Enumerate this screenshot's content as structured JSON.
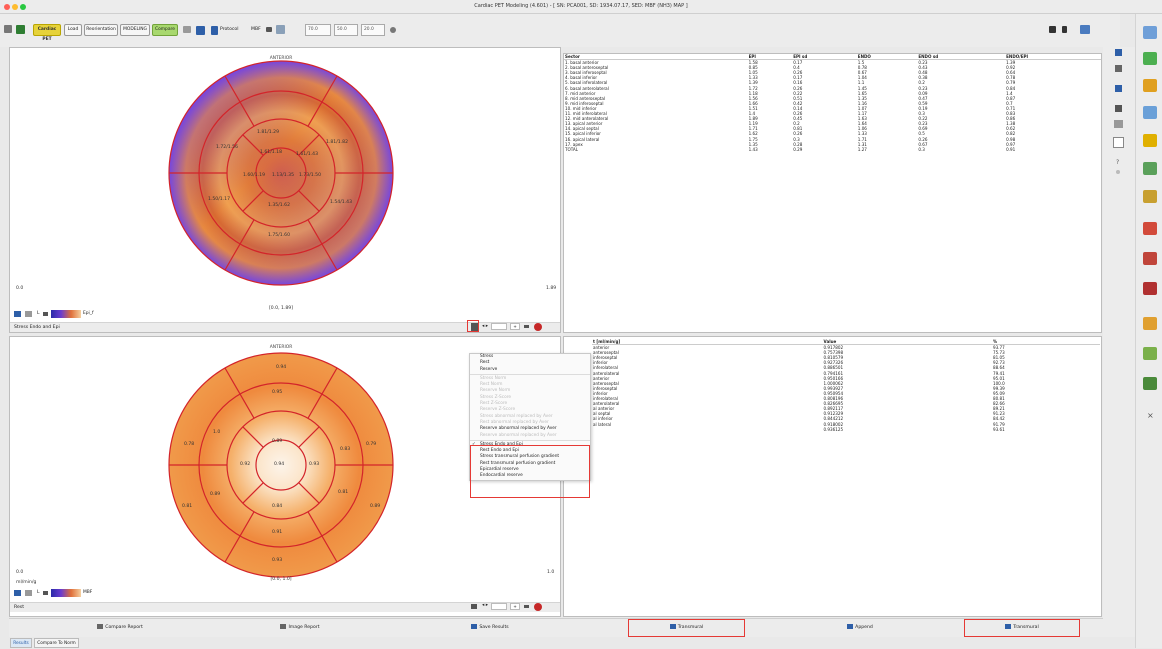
{
  "window": {
    "title": "Cardiac PET Modeling (4.601) - [ SN: PCA001, SD: 1934.07.17, SED: MBF (NH3) MAP ]"
  },
  "toolbar": {
    "mode_label": "Cardiac PET",
    "buttons": [
      "Load",
      "Reorientation",
      "MODELING",
      "Compare"
    ],
    "protocol_label": "Protocol",
    "mbf_label": "MBF",
    "field1": "70.0",
    "field2": "50.0",
    "field3": "20.0"
  },
  "top_panel": {
    "anterior_label": "ANTERIOR",
    "scale_min": "0.0",
    "scale_max": "1.89",
    "range_label": "[0.0, 1.89]",
    "colorbar_label": "Epi_f",
    "dropdown_label": "Stress Endo and Epi",
    "rings": {
      "outer": [
        "1.81/1.29",
        "1.81/1.75",
        "1.81/1.82",
        "1.79/1.23",
        "1.75/1.60",
        "1.72/1.56"
      ],
      "middle": [
        "1.61/1.18",
        "1.61/1.43",
        "1.57/1.42",
        "1.54/1.43",
        "1.53/1.43",
        "1.50/1.17"
      ],
      "inner": [
        "1.60/1.19",
        "1.73/1.50",
        "1.35/1.62",
        "1.57/1.23"
      ],
      "apex": "1.13/1.35"
    }
  },
  "bottom_panel": {
    "anterior_label": "ANTERIOR",
    "scale_min": "0.0",
    "scale_max": "1.0",
    "range_label": "[0.0, 1.0]",
    "units_label": "ml/min/g",
    "colorbar_label": "MBF",
    "dropdown_label": "Rest",
    "rings": {
      "outer": [
        "0.94",
        "0.79",
        "0.89",
        "0.93",
        "0.78",
        "0.81"
      ],
      "middle": [
        "0.95",
        "0.83",
        "0.81",
        "0.84",
        "0.89",
        "1.0"
      ],
      "inner": [
        "0.89",
        "0.92",
        "0.93",
        "0.91"
      ],
      "apex": "0.94",
      "bottom_extra": "0.93"
    }
  },
  "table_top": {
    "headers": [
      "Sector",
      "EPI",
      "EPI sd",
      "ENDO",
      "ENDO sd",
      "ENDO/EPI"
    ],
    "rows": [
      [
        "1. basal anterior",
        "1.58",
        "0.17",
        "1.5",
        "0.23",
        "1.39"
      ],
      [
        "2. basal anteroseptal",
        "0.85",
        "0.4",
        "0.78",
        "0.43",
        "0.92"
      ],
      [
        "3. basal inferoseptal",
        "1.05",
        "0.26",
        "0.67",
        "0.48",
        "0.64"
      ],
      [
        "4. basal inferior",
        "1.33",
        "0.17",
        "1.04",
        "0.38",
        "0.78"
      ],
      [
        "5. basal inferolateral",
        "1.39",
        "0.16",
        "1.1",
        "0.2",
        "0.79"
      ],
      [
        "6. basal anterolateral",
        "1.72",
        "0.26",
        "1.45",
        "0.23",
        "0.84"
      ],
      [
        "7. mid anterior",
        "1.18",
        "0.22",
        "1.65",
        "0.09",
        "1.4"
      ],
      [
        "8. mid anteroseptal",
        "1.56",
        "0.51",
        "1.35",
        "0.47",
        "0.87"
      ],
      [
        "9. mid inferoseptal",
        "1.66",
        "0.42",
        "1.16",
        "0.59",
        "0.7"
      ],
      [
        "10. mid inferior",
        "1.51",
        "0.14",
        "1.07",
        "0.19",
        "0.71"
      ],
      [
        "11. mid inferolateral",
        "1.4",
        "0.26",
        "1.17",
        "0.3",
        "0.83"
      ],
      [
        "12. mid anterolateral",
        "1.89",
        "0.45",
        "1.63",
        "0.22",
        "0.86"
      ],
      [
        "13. apical anterior",
        "1.19",
        "0.2",
        "1.64",
        "0.23",
        "1.38"
      ],
      [
        "14. apical septal",
        "1.71",
        "0.81",
        "1.06",
        "0.69",
        "0.62"
      ],
      [
        "15. apical inferior",
        "1.62",
        "0.26",
        "1.33",
        "0.5",
        "0.82"
      ],
      [
        "16. apical lateral",
        "1.75",
        "0.3",
        "1.71",
        "0.26",
        "0.98"
      ],
      [
        "17. apex",
        "1.35",
        "0.28",
        "1.31",
        "0.67",
        "0.97"
      ],
      [
        "TOTAL",
        "1.43",
        "0.29",
        "1.27",
        "0.3",
        "0.91"
      ]
    ]
  },
  "table_bottom": {
    "headers": [
      "t [ml/min/g]",
      "Value",
      "%"
    ],
    "rows": [
      [
        "anterior",
        "0.917802",
        "93.77"
      ],
      [
        "anteroseptal",
        "0.757398",
        "75.73"
      ],
      [
        "inferoseptal",
        "0.810579",
        "81.05"
      ],
      [
        "inferior",
        "0.927326",
        "92.73"
      ],
      [
        "inferolateral",
        "0.886501",
        "88.64"
      ],
      [
        "anterolateral",
        "0.794161",
        "79.41"
      ],
      [
        "anterior",
        "0.950166",
        "95.01"
      ],
      [
        "anteroseptal",
        "1.000062",
        "100.0"
      ],
      [
        "inferoseptal",
        "0.993927",
        "99.39"
      ],
      [
        "inferior",
        "0.950954",
        "95.09"
      ],
      [
        "inferolateral",
        "0.808196",
        "80.81"
      ],
      [
        "anterolateral",
        "0.826695",
        "82.66"
      ],
      [
        "al anterior",
        "0.892117",
        "89.21"
      ],
      [
        "al septal",
        "0.912329",
        "91.23"
      ],
      [
        "al inferior",
        "0.844212",
        "84.42"
      ],
      [
        "al lateral",
        "0.918002",
        "91.79"
      ],
      [
        "",
        "0.936125",
        "93.61"
      ]
    ]
  },
  "dropdown_menu": {
    "items_top": [
      "Stress",
      "Rest",
      "Reserve"
    ],
    "items_disabled": [
      "Stress Norm",
      "Rest Norm",
      "Reserve Norm",
      "Stress Z-Score",
      "Rest Z-Score",
      "Reserve Z-Score",
      "Stress abnormal replaced by Aver",
      "Rest abnormal replaced by Aver"
    ],
    "item_reserve_replaced": "Reserve abnormal replaced by Aver",
    "item_disabled_last": "Reserve abnormal replaced by Aver",
    "items_bottom": [
      "Stress Endo and Epi",
      "Rest Endo and Epi",
      "Stress transmural perfusion gradient",
      "Rest transmural perfusion gradient",
      "Epicardial reserve",
      "Endocardial reserve"
    ]
  },
  "bottom_buttons": [
    "Compare Report",
    "Image Report",
    "Save Results",
    "Transmural",
    "Append",
    "Transmural"
  ],
  "tabs": [
    "Results",
    "Compare To Norm"
  ]
}
